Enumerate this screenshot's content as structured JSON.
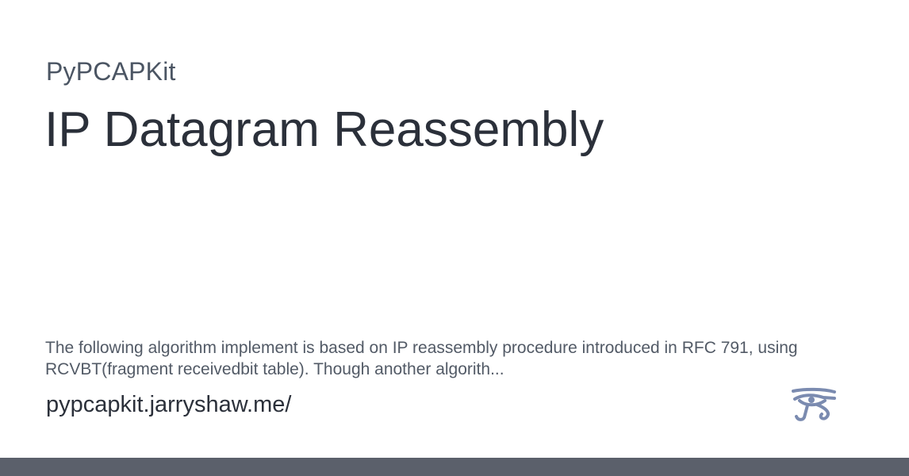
{
  "site": {
    "name": "PyPCAPKit",
    "url": "pypcapkit.jarryshaw.me/"
  },
  "page": {
    "title": "IP Datagram Reassembly",
    "description": "The following algorithm implement is based on IP reassembly procedure introduced in RFC 791, using RCVBT(fragment receivedbit table). Though another algorith..."
  },
  "logo": {
    "icon": "eye-of-horus-icon",
    "color": "#7b8bb0"
  },
  "footer": {
    "bar_color": "#5b606b"
  }
}
